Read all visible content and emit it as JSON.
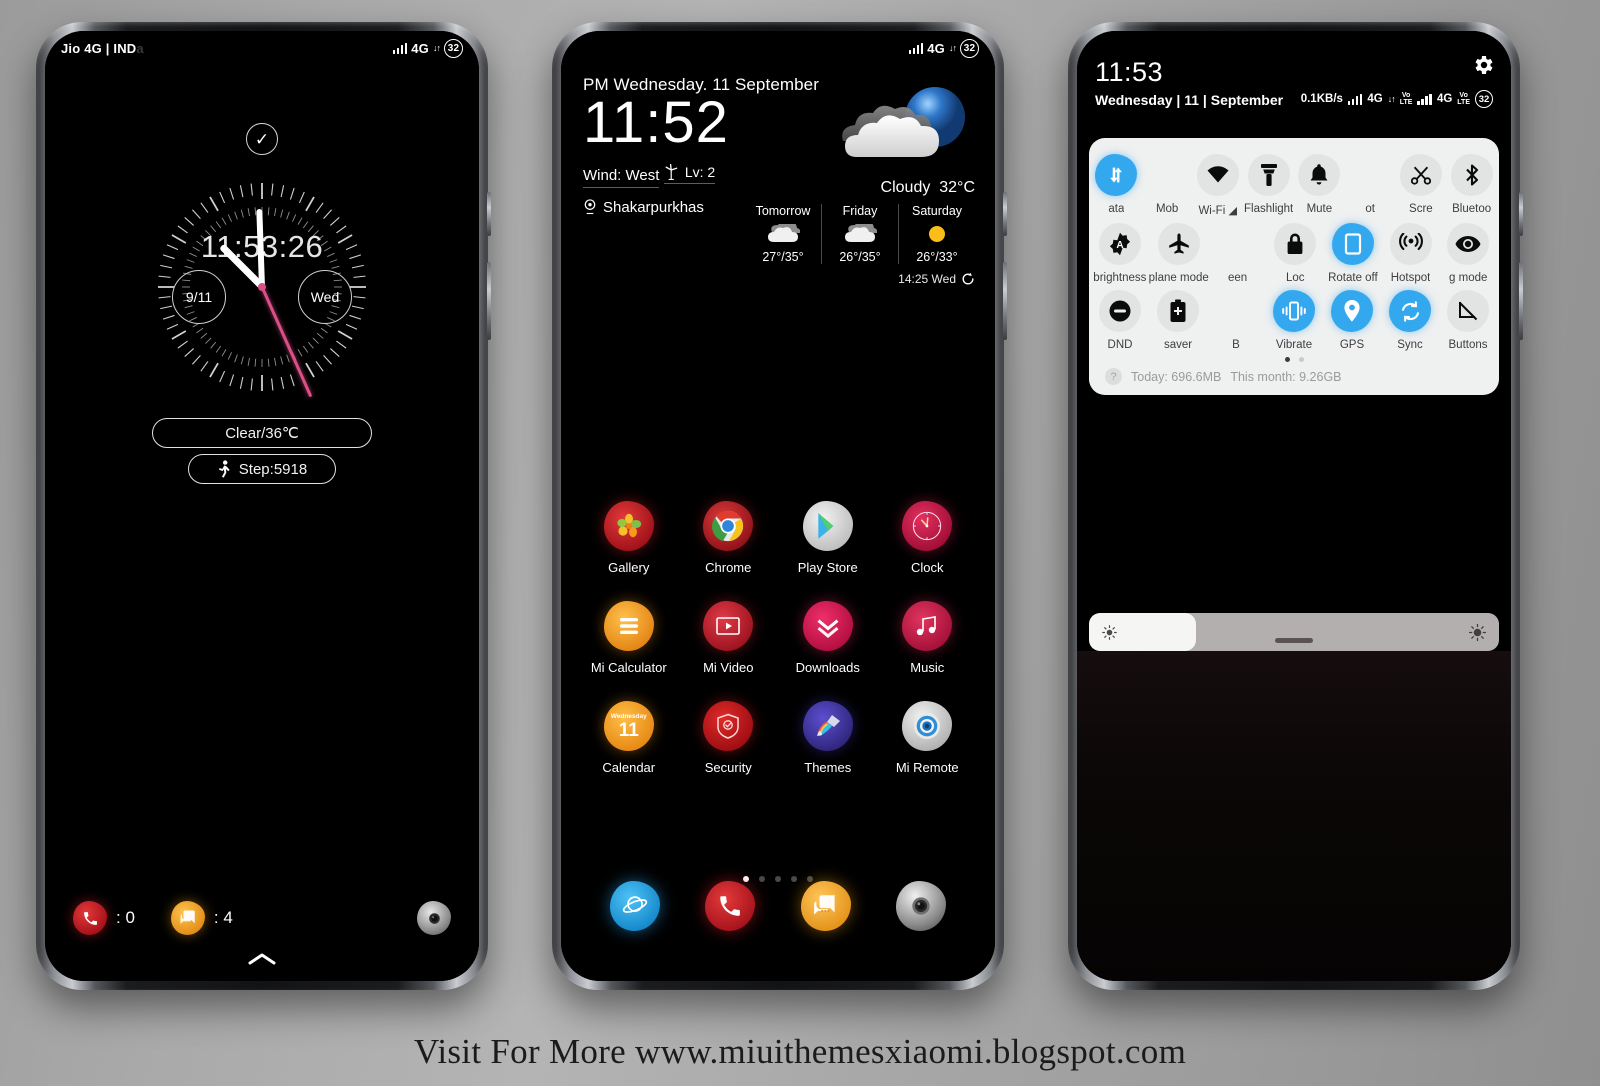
{
  "footer": {
    "text": "Visit For More www.miuithemesxiaomi.blogspot.com"
  },
  "lock_screen": {
    "status_bar": {
      "carrier": "Jio 4G | IND",
      "carrier_dim": "a",
      "network": "4G",
      "battery": "32"
    },
    "clock": {
      "digital_time": "11:53:26",
      "subdial_left": "9/11",
      "subdial_right": "Wed"
    },
    "weather_pill": "Clear/36℃",
    "step_pill": "Step:5918",
    "shortcuts": [
      {
        "icon": "phone-icon",
        "count": ": 0"
      },
      {
        "icon": "messages-icon",
        "count": ": 4"
      }
    ],
    "camera_icon": "camera-icon",
    "unlock_arrow": "chevron-up-icon"
  },
  "home_screen": {
    "status_bar": {
      "network": "4G",
      "battery": "32"
    },
    "weather_widget": {
      "date": "PM Wednesday. 11 September",
      "time": "11:52",
      "wind": "Wind: West",
      "wind_level": "Lv: 2",
      "location": "Shakarpurkhas",
      "condition": "Cloudy",
      "temperature": "32°C",
      "forecast": [
        {
          "day": "Tomorrow",
          "icon": "cloudy-icon",
          "temps": "27°/35°"
        },
        {
          "day": "Friday",
          "icon": "cloudy-icon",
          "temps": "26°/35°"
        },
        {
          "day": "Saturday",
          "icon": "sunny-icon",
          "temps": "26°/33°"
        }
      ],
      "updated": "14:25 Wed"
    },
    "apps": [
      [
        {
          "label": "Gallery",
          "icon": "gallery-icon"
        },
        {
          "label": "Chrome",
          "icon": "chrome-icon"
        },
        {
          "label": "Play Store",
          "icon": "play-store-icon"
        },
        {
          "label": "Clock",
          "icon": "clock-icon"
        }
      ],
      [
        {
          "label": "Mi Calculator",
          "icon": "calculator-icon"
        },
        {
          "label": "Mi Video",
          "icon": "video-icon"
        },
        {
          "label": "Downloads",
          "icon": "downloads-icon"
        },
        {
          "label": "Music",
          "icon": "music-icon"
        }
      ],
      [
        {
          "label": "Calendar",
          "icon": "calendar-icon",
          "day_name": "Wednesday",
          "day_num": "11"
        },
        {
          "label": "Security",
          "icon": "security-shield-icon"
        },
        {
          "label": "Themes",
          "icon": "themes-icon"
        },
        {
          "label": "Mi Remote",
          "icon": "mi-remote-icon"
        }
      ]
    ],
    "page_dots": {
      "count": 5,
      "active": 0
    },
    "dock": [
      {
        "label": "browser",
        "icon": "browser-icon"
      },
      {
        "label": "phone",
        "icon": "phone-icon"
      },
      {
        "label": "messages",
        "icon": "messages-icon"
      },
      {
        "label": "camera",
        "icon": "camera-icon"
      }
    ]
  },
  "notification_shade": {
    "time": "11:53",
    "date": "Wednesday | 11 | September",
    "data_speed": "0.1KB/s",
    "sim1_net": "4G",
    "sim1_volte": "Vo LTE",
    "sim2_net": "4G",
    "sim2_volte": "Vo LTE",
    "battery": "32",
    "settings_icon": "gear-icon",
    "quick_settings": [
      [
        {
          "label": "ata",
          "icon": "mobile-data-icon",
          "state": "on",
          "clip": "left"
        },
        {
          "label": "Mob",
          "icon": "mobile-data-2-icon",
          "state": "off",
          "clip": "right"
        },
        {
          "label": "Wi-Fi",
          "icon": "wifi-icon",
          "state": "off"
        },
        {
          "label": "Flashlight",
          "icon": "flashlight-icon",
          "state": "off"
        },
        {
          "label": "Mute",
          "icon": "bell-icon",
          "state": "off"
        },
        {
          "label": "ot",
          "icon": "screenshot-icon",
          "state": "off",
          "clip": "left"
        },
        {
          "label": "Scre",
          "icon": "scissors-icon",
          "state": "off",
          "clip": "right"
        },
        {
          "label": "Bluetoo",
          "icon": "bluetooth-icon",
          "state": "off",
          "clip": "right"
        }
      ],
      [
        {
          "label": "brightness",
          "icon": "auto-brightness-icon",
          "state": "off"
        },
        {
          "label": "plane mode",
          "icon": "airplane-icon",
          "state": "off"
        },
        {
          "label": "een",
          "icon": "screen-lock-icon",
          "state": "off"
        },
        {
          "label": "Loc",
          "icon": "lock-icon",
          "state": "off",
          "clip": "right"
        },
        {
          "label": "Rotate off",
          "icon": "rotate-icon",
          "state": "on"
        },
        {
          "label": "Hotspot",
          "icon": "hotspot-icon",
          "state": "off"
        },
        {
          "label": "g mode",
          "icon": "reading-mode-eye-icon",
          "state": "off",
          "clip": "left"
        }
      ],
      [
        {
          "label": "DND",
          "icon": "dnd-icon",
          "state": "off"
        },
        {
          "label": "saver",
          "icon": "battery-saver-icon",
          "state": "off",
          "clip": "left"
        },
        {
          "label": "B",
          "icon": "blank-icon",
          "state": "off"
        },
        {
          "label": "Vibrate",
          "icon": "vibrate-icon",
          "state": "on"
        },
        {
          "label": "GPS",
          "icon": "gps-icon",
          "state": "on"
        },
        {
          "label": "Sync",
          "icon": "sync-icon",
          "state": "on"
        },
        {
          "label": "Buttons",
          "icon": "buttons-off-icon",
          "state": "off"
        }
      ]
    ],
    "page_dots": {
      "count": 2,
      "active": 0
    },
    "data_usage": {
      "help_icon": "question-icon",
      "today": "Today: 696.6MB",
      "month": "This month: 9.26GB"
    },
    "brightness": {
      "low_icon": "brightness-low-icon",
      "high_icon": "brightness-high-icon",
      "value_percent": 26
    }
  },
  "colors": {
    "accent_blue": "#34a8ef",
    "second_hand": "#d94f86",
    "panel_bg": "#eff0f0"
  }
}
